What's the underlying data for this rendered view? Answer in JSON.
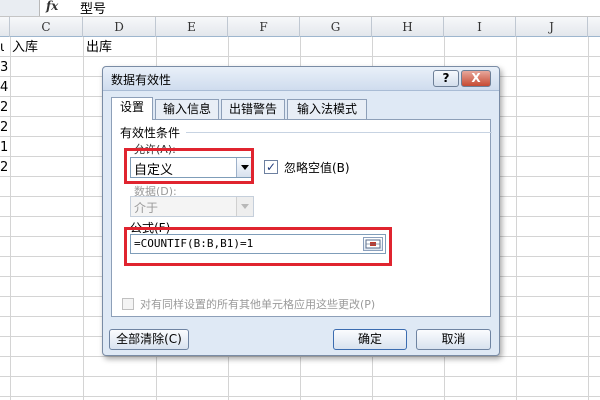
{
  "formula_bar": {
    "fx": "fx",
    "content": "型号"
  },
  "columns": [
    "C",
    "D",
    "E",
    "F",
    "G",
    "H",
    "I",
    "J"
  ],
  "cells": {
    "row1_b": "ι",
    "row1_c": "入库",
    "row1_d": "出库",
    "col_b_values": [
      "3",
      "4",
      "2",
      "2",
      "1",
      "2"
    ]
  },
  "dialog": {
    "title": "数据有效性",
    "help": "?",
    "close": "X",
    "tabs": [
      "设置",
      "输入信息",
      "出错警告",
      "输入法模式"
    ],
    "section": "有效性条件",
    "allow_label": "允许(A):",
    "allow_value": "自定义",
    "ignore_blank": {
      "checked": true,
      "label": "忽略空值(B)"
    },
    "data_label": "数据(D):",
    "data_value": "介于",
    "formula_label": "公式(F)",
    "formula_value": "=COUNTIF(B:B,B1)=1",
    "apply_all": {
      "checked": false,
      "label": "对有同样设置的所有其他单元格应用这些更改(P)"
    },
    "buttons": {
      "clear": "全部清除(C)",
      "ok": "确定",
      "cancel": "取消"
    }
  },
  "colors": {
    "highlight": "#e0242f",
    "dialog_bg": "#dfe9f5"
  }
}
